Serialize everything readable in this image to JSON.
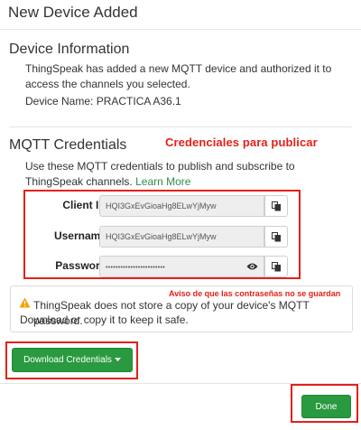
{
  "header": {
    "title": "New Device Added"
  },
  "device_info": {
    "heading": "Device Information",
    "description": "ThingSpeak has added a new MQTT device and authorized it to access the channels you selected.",
    "device_name": "Device Name: PRACTICA A36.1"
  },
  "mqtt": {
    "heading": "MQTT Credentials",
    "annotation": "Credenciales para publicar",
    "description": "Use these MQTT credentials to publish and subscribe to ThingSpeak channels.",
    "learn_more": "Learn More",
    "fields": [
      {
        "label": "Client ID",
        "value": "HQI3GxEvGioaHg8ELwYjMyw"
      },
      {
        "label": "Username",
        "value": "HQI3GxEvGioaHg8ELwYjMyw"
      },
      {
        "label": "Password",
        "value": "••••••••••••••••••••••••"
      }
    ]
  },
  "alert": {
    "annotation": "Aviso de que las contraseñas no se guardan",
    "line1": "ThingSpeak does not store a copy of your device's MQTT password.",
    "line2": "Download or copy it to keep it safe."
  },
  "actions": {
    "download_label": "Download Credentials",
    "done_label": "Done"
  },
  "colors": {
    "accent_green": "#2a9a40",
    "annotation_red": "#e32119"
  },
  "icons": [
    "copy-icon",
    "eye-icon",
    "warning-icon",
    "caret-down-icon"
  ]
}
